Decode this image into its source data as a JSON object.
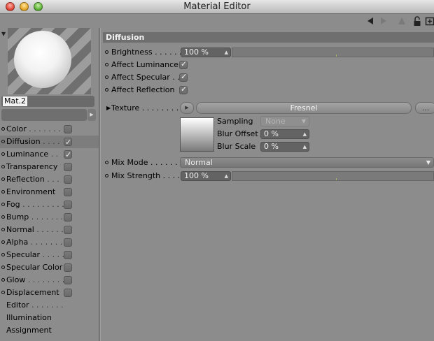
{
  "window": {
    "title": "Material Editor"
  },
  "toolbar": {
    "icons": [
      "back-arrow-icon",
      "forward-arrow-icon",
      "up-arrow-icon",
      "lock-icon",
      "new-window-icon"
    ]
  },
  "material": {
    "name": "Mat.2"
  },
  "channels": [
    {
      "label": "Color",
      "dots": ". . . . . . . .",
      "checked": false,
      "has_checkbox": true,
      "has_bullet": true
    },
    {
      "label": "Diffusion",
      "dots": ". . . .",
      "checked": true,
      "has_checkbox": true,
      "has_bullet": true,
      "active": true
    },
    {
      "label": "Luminance",
      "dots": ". .",
      "checked": true,
      "has_checkbox": true,
      "has_bullet": true
    },
    {
      "label": "Transparency",
      "dots": "",
      "checked": false,
      "has_checkbox": true,
      "has_bullet": true
    },
    {
      "label": "Reflection",
      "dots": ". . .",
      "checked": false,
      "has_checkbox": true,
      "has_bullet": true
    },
    {
      "label": "Environment",
      "dots": "",
      "checked": false,
      "has_checkbox": true,
      "has_bullet": true
    },
    {
      "label": "Fog",
      "dots": ". . . . . . . . .",
      "checked": false,
      "has_checkbox": true,
      "has_bullet": true
    },
    {
      "label": "Bump",
      "dots": ". . . . . . .",
      "checked": false,
      "has_checkbox": true,
      "has_bullet": true
    },
    {
      "label": "Normal",
      "dots": ". . . . . .",
      "checked": false,
      "has_checkbox": true,
      "has_bullet": true
    },
    {
      "label": "Alpha",
      "dots": ". . . . . . .",
      "checked": false,
      "has_checkbox": true,
      "has_bullet": true
    },
    {
      "label": "Specular",
      "dots": ". . . . .",
      "checked": false,
      "has_checkbox": true,
      "has_bullet": true
    },
    {
      "label": "Specular Color",
      "dots": "",
      "checked": false,
      "has_checkbox": true,
      "has_bullet": true
    },
    {
      "label": "Glow",
      "dots": ". . . . . . . .",
      "checked": false,
      "has_checkbox": true,
      "has_bullet": true
    },
    {
      "label": "Displacement",
      "dots": "",
      "checked": false,
      "has_checkbox": true,
      "has_bullet": true
    },
    {
      "label": "Editor",
      "dots": ". . . . . . .",
      "has_checkbox": false,
      "has_bullet": false
    },
    {
      "label": "Illumination",
      "dots": "",
      "has_checkbox": false,
      "has_bullet": false
    },
    {
      "label": "Assignment",
      "dots": "",
      "has_checkbox": false,
      "has_bullet": false
    }
  ],
  "diffusion": {
    "section_title": "Diffusion",
    "brightness": {
      "label": "Brightness",
      "dots": ". . . . . .",
      "value": "100 %",
      "slider_fraction": 1.0
    },
    "affect_luminance": {
      "label": "Affect Luminance",
      "checked": true
    },
    "affect_specular": {
      "label": "Affect Specular",
      "dots": ". .",
      "checked": true
    },
    "affect_reflection": {
      "label": "Affect Reflection",
      "checked": true
    },
    "texture": {
      "label": "Texture",
      "dots": ". . . . . . . . .",
      "shader": "Fresnel",
      "more_label": "..."
    },
    "sampling": {
      "label": "Sampling",
      "value": "None"
    },
    "blur_offset": {
      "label": "Blur Offset",
      "value": "0 %"
    },
    "blur_scale": {
      "label": "Blur Scale",
      "value": "0 %"
    },
    "mix_mode": {
      "label": "Mix Mode",
      "dots": ". . . . . . .",
      "value": "Normal"
    },
    "mix_strength": {
      "label": "Mix Strength",
      "dots": ". . . .",
      "value": "100 %",
      "slider_fraction": 1.0
    }
  }
}
